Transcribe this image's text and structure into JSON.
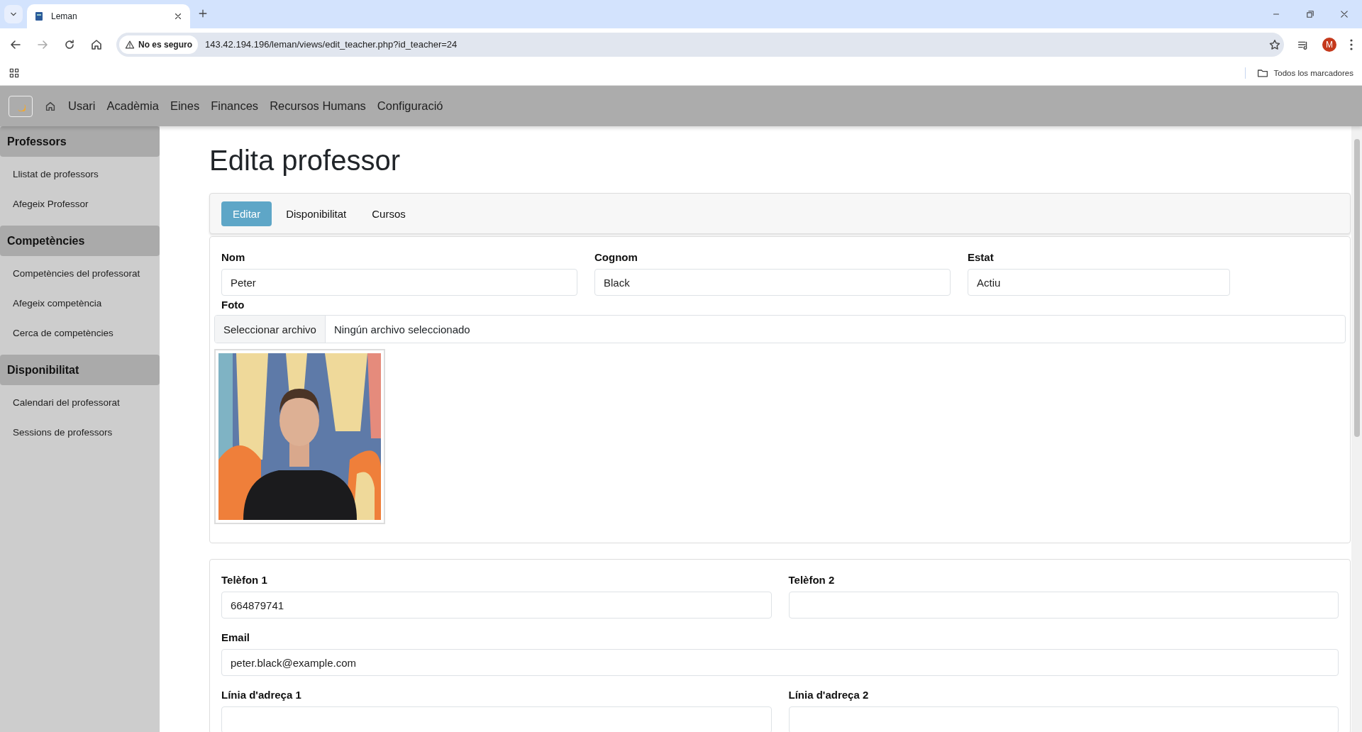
{
  "browser": {
    "tab_title": "Leman",
    "security_label": "No es seguro",
    "url": "143.42.194.196/leman/views/edit_teacher.php?id_teacher=24",
    "profile_initial": "M",
    "bookmarks_label": "Todos los marcadores"
  },
  "navbar": {
    "items": [
      "Usari",
      "Acadèmia",
      "Eines",
      "Finances",
      "Recursos Humans",
      "Configuració"
    ]
  },
  "sidebar": {
    "sections": [
      {
        "title": "Professors",
        "items": [
          "Llistat de professors",
          "Afegeix Professor"
        ]
      },
      {
        "title": "Competències",
        "items": [
          "Competències del professorat",
          "Afegeix competència",
          "Cerca de competències"
        ]
      },
      {
        "title": "Disponibilitat",
        "items": [
          "Calendari del professorat",
          "Sessions de professors"
        ]
      }
    ]
  },
  "page_title": "Edita professor",
  "tabs": [
    {
      "label": "Editar",
      "selected": true
    },
    {
      "label": "Disponibilitat",
      "selected": false
    },
    {
      "label": "Cursos",
      "selected": false
    }
  ],
  "general": {
    "fields": [
      {
        "label": "Nom",
        "value": "Peter"
      },
      {
        "label": "Cognom",
        "value": "Black"
      },
      {
        "label": "Estat",
        "value": "Actiu"
      }
    ],
    "photo": {
      "label": "Foto",
      "file_button": "Seleccionar archivo",
      "file_status": "Ningún archivo seleccionado",
      "kind": "picture"
    }
  },
  "contact": {
    "rows": [
      [
        {
          "label": "Telèfon 1",
          "value": "664879741"
        },
        {
          "label": "Telèfon 2"
        }
      ],
      [
        {
          "label": "Email",
          "value": "peter.black@example.com"
        }
      ],
      [
        {
          "label": "Línia d'adreça 1"
        },
        {
          "label": "Línia d'adreça 2"
        }
      ]
    ]
  }
}
